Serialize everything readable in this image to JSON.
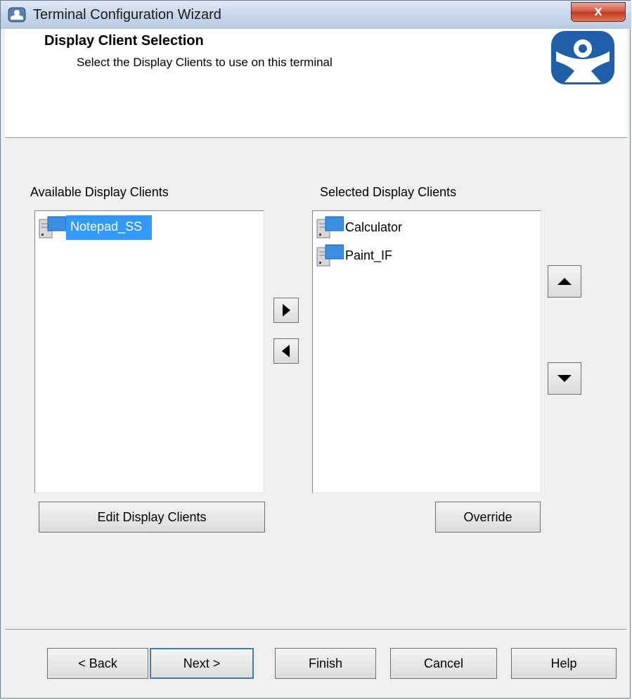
{
  "window": {
    "title": "Terminal Configuration Wizard",
    "close_label": "x"
  },
  "header": {
    "title": "Display Client Selection",
    "subtitle": "Select the Display Clients to use on this terminal"
  },
  "available": {
    "label": "Available Display Clients",
    "items": [
      {
        "label": "Notepad_SS",
        "selected": true
      }
    ]
  },
  "selected": {
    "label": "Selected Display Clients",
    "items": [
      {
        "label": "Calculator"
      },
      {
        "label": "Paint_IF"
      }
    ]
  },
  "buttons": {
    "edit": "Edit Display Clients",
    "override": "Override",
    "back": "< Back",
    "next": "Next >",
    "finish": "Finish",
    "cancel": "Cancel",
    "help": "Help"
  },
  "colors": {
    "selection": "#3399ff",
    "logo_blue": "#1f5fa8"
  },
  "icons": [
    "display-client-icon",
    "arrow-right-icon",
    "arrow-left-icon",
    "arrow-up-icon",
    "arrow-down-icon",
    "thinmanager-logo-icon"
  ]
}
